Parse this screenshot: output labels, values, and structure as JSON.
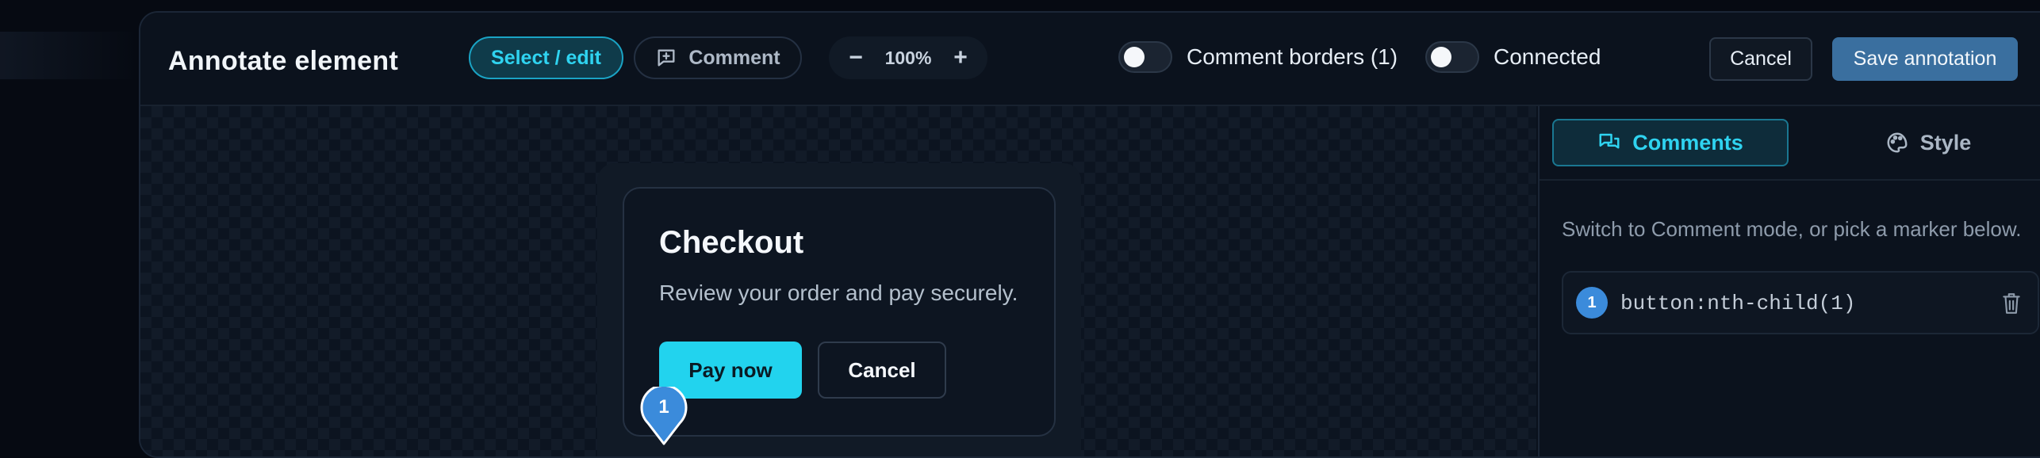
{
  "toolbar": {
    "title": "Annotate element",
    "select_edit_label": "Select / edit",
    "comment_label": "Comment",
    "zoom_minus": "−",
    "zoom_value": "100%",
    "zoom_plus": "+",
    "comment_borders_label": "Comment borders (1)",
    "comment_borders_on": false,
    "connected_label": "Connected",
    "connected_on": false,
    "cancel_label": "Cancel",
    "save_label": "Save annotation"
  },
  "preview": {
    "card_title": "Checkout",
    "card_subtitle": "Review your order and pay securely.",
    "pay_label": "Pay now",
    "cancel_label": "Cancel",
    "marker_number": "1"
  },
  "sidebar": {
    "tabs": [
      {
        "label": "Comments",
        "icon": "chat-bubbles-icon",
        "active": true
      },
      {
        "label": "Style",
        "icon": "palette-icon",
        "active": false
      }
    ],
    "hint": "Switch to Comment mode, or pick a marker below.",
    "comments": [
      {
        "number": "1",
        "selector": "button:nth-child(1)"
      }
    ]
  },
  "colors": {
    "accent": "#22d3ee",
    "marker": "#3b8bdb",
    "save_button": "#3a6f9f"
  }
}
